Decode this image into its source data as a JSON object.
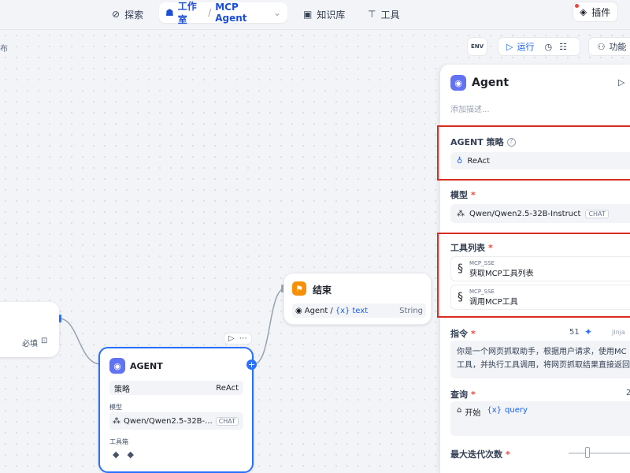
{
  "topbar": {
    "explore_label": "探索",
    "studio_label": "工作室",
    "app_name": "MCP Agent",
    "knowledge_label": "知识库",
    "tools_label": "工具",
    "plugin_label": "插件"
  },
  "canvas": {
    "publish_label": "布",
    "env_label": "ENV",
    "run_label": "运行",
    "features_label": "功能"
  },
  "nodes": {
    "left": {
      "required_label": "必填"
    },
    "end": {
      "title": "结束",
      "var_source": "Agent",
      "var_sep": "/",
      "var_icon": "{x}",
      "var_name": "text",
      "var_type": "String"
    },
    "agent": {
      "title": "AGENT",
      "strategy_label": "策略",
      "strategy_value": "ReAct",
      "model_label": "模型",
      "model_value": "Qwen/Qwen2.5-32B-...",
      "model_badge": "CHAT",
      "tools_label": "工具箱"
    }
  },
  "panel": {
    "title": "Agent",
    "description_placeholder": "添加描述...",
    "strategy_label": "AGENT 策略",
    "strategy_value": "ReAct",
    "model_label": "模型",
    "model_value": "Qwen/Qwen2.5-32B-Instruct",
    "model_badge": "CHAT",
    "tools_label": "工具列表",
    "tools": [
      {
        "provider": "MCP_SSE",
        "name": "获取MCP工具列表"
      },
      {
        "provider": "MCP_SSE",
        "name": "调用MCP工具"
      }
    ],
    "instruction_label": "指令",
    "instruction_count": "51",
    "instruction_mode": "Jinja",
    "instruction_line1": "你是一个网页抓取助手，根据用户请求，使用MC",
    "instruction_line2": "工具，并执行工具调用，将网页抓取结果直接返回",
    "query_label": "查询",
    "query_count": "2",
    "query_source": "开始",
    "query_var_icon": "{x}",
    "query_var": "query",
    "max_iter_label": "最大迭代次数"
  }
}
